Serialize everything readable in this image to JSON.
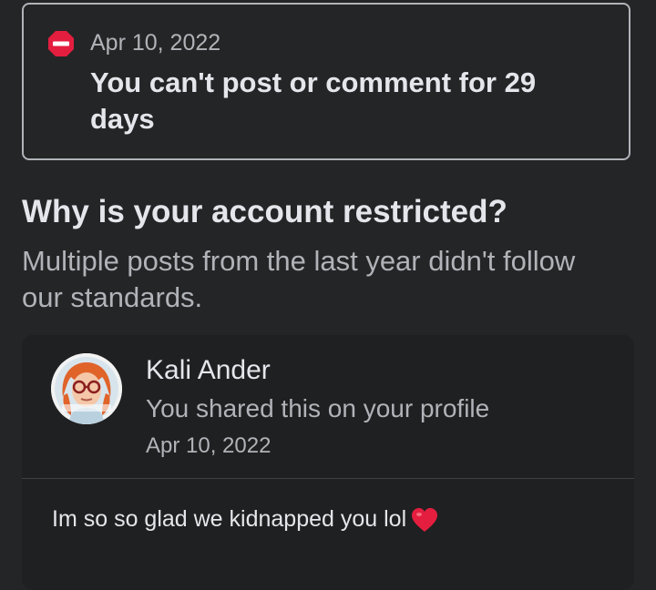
{
  "restriction": {
    "icon": "stop-icon",
    "date": "Apr 10, 2022",
    "message": "You can't post or comment for 29 days",
    "icon_color": "#e41e3f"
  },
  "reason": {
    "heading": "Why is your account restricted?",
    "explanation": "Multiple posts from the last year didn't follow our standards."
  },
  "post": {
    "author_name": "Kali Ander",
    "avatar_icon": "profile-photo",
    "share_context": "You shared this on your profile",
    "date": "Apr 10, 2022",
    "text": "Im so so glad we kidnapped you lol",
    "emoji": "heart-icon",
    "emoji_color": "#e41e3f"
  }
}
